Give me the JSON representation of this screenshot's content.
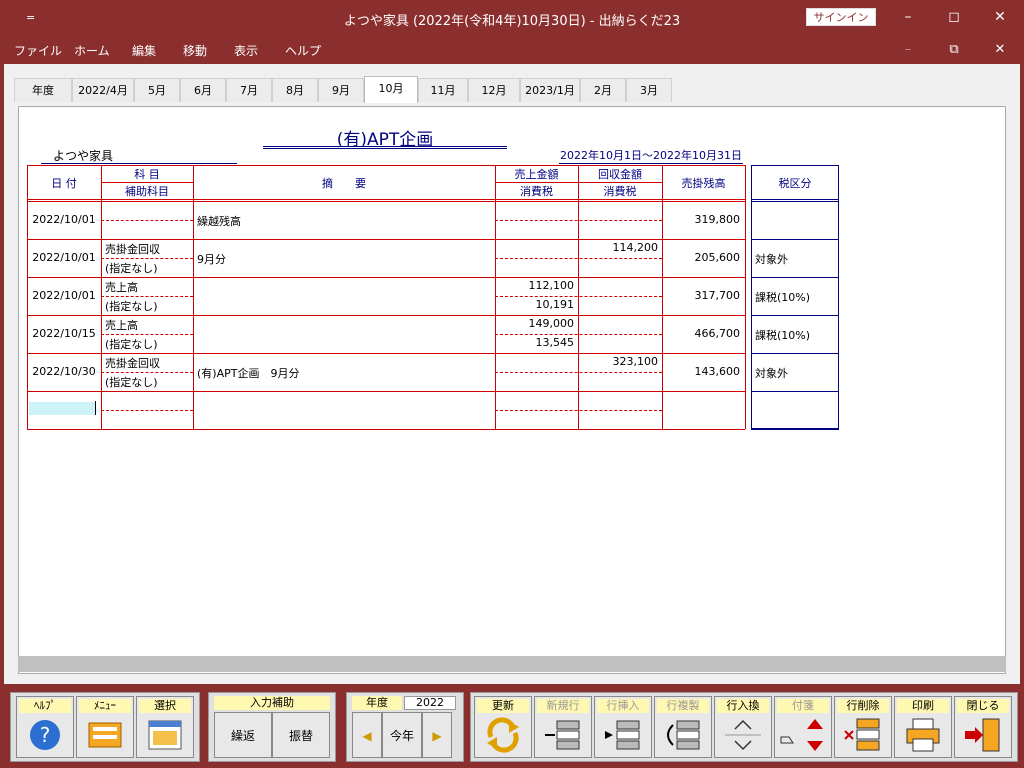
{
  "window": {
    "title": "よつや家具 (2022年(令和4年)10月30日)  -  出納らくだ23",
    "signin": "サインイン",
    "qa": "="
  },
  "menu": [
    "ファイル",
    "ホーム",
    "編集",
    "移動",
    "表示",
    "ヘルプ"
  ],
  "tabs": [
    "年度",
    "2022/4月",
    "5月",
    "6月",
    "7月",
    "8月",
    "9月",
    "10月",
    "11月",
    "12月",
    "2023/1月",
    "2月",
    "3月"
  ],
  "active_tab": "10月",
  "header": {
    "company": "よつや家具",
    "title": "(有)APT企画",
    "period": "2022年10月1日～2022年10月31日"
  },
  "columns": {
    "date": "日 付",
    "account": "科 目",
    "sub_account": "補助科目",
    "memo": "摘　　要",
    "sales": "売上金額",
    "sales_tax": "消費税",
    "collect": "回収金額",
    "collect_tax": "消費税",
    "balance": "売掛残高",
    "tax_class": "税区分"
  },
  "rows": [
    {
      "date": "2022/10/01",
      "account": "",
      "sub": "",
      "memo": "繰越残高",
      "sales": "",
      "sales_tax": "",
      "collect": "",
      "collect_tax": "",
      "balance": "319,800",
      "tax": ""
    },
    {
      "date": "2022/10/01",
      "account": "売掛金回収",
      "sub": "(指定なし)",
      "memo": "9月分",
      "sales": "",
      "sales_tax": "",
      "collect": "114,200",
      "collect_tax": "",
      "balance": "205,600",
      "tax": "対象外"
    },
    {
      "date": "2022/10/01",
      "account": "売上高",
      "sub": "(指定なし)",
      "memo": "",
      "sales": "112,100",
      "sales_tax": "10,191",
      "collect": "",
      "collect_tax": "",
      "balance": "317,700",
      "tax": "課税(10%)"
    },
    {
      "date": "2022/10/15",
      "account": "売上高",
      "sub": "(指定なし)",
      "memo": "",
      "sales": "149,000",
      "sales_tax": "13,545",
      "collect": "",
      "collect_tax": "",
      "balance": "466,700",
      "tax": "課税(10%)"
    },
    {
      "date": "2022/10/30",
      "account": "売掛金回収",
      "sub": "(指定なし)",
      "memo": "(有)APT企画　9月分",
      "sales": "",
      "sales_tax": "",
      "collect": "323,100",
      "collect_tax": "",
      "balance": "143,600",
      "tax": "対象外"
    },
    {
      "date": "",
      "account": "",
      "sub": "",
      "memo": "",
      "sales": "",
      "sales_tax": "",
      "collect": "",
      "collect_tax": "",
      "balance": "",
      "tax": ""
    }
  ],
  "toolbar": {
    "help": "ﾍﾙﾌﾟ",
    "menu": "ﾒﾆｭｰ",
    "select": "選択",
    "input_assist": "入力補助",
    "kurikaeshi": "繰返",
    "furikae": "振替",
    "year_label": "年度",
    "year_value": "2022",
    "this_year": "今年",
    "update": "更新",
    "new_row": "新規行",
    "insert_row": "行挿入",
    "copy_row": "行複製",
    "swap_row": "行入換",
    "tag": "付箋",
    "delete_row": "行削除",
    "print": "印刷",
    "close": "閉じる"
  },
  "colors": {
    "accent": "#8b2e2e",
    "grid": "#cc0000",
    "navy": "#000080",
    "label_bg": "#fff8b0"
  }
}
